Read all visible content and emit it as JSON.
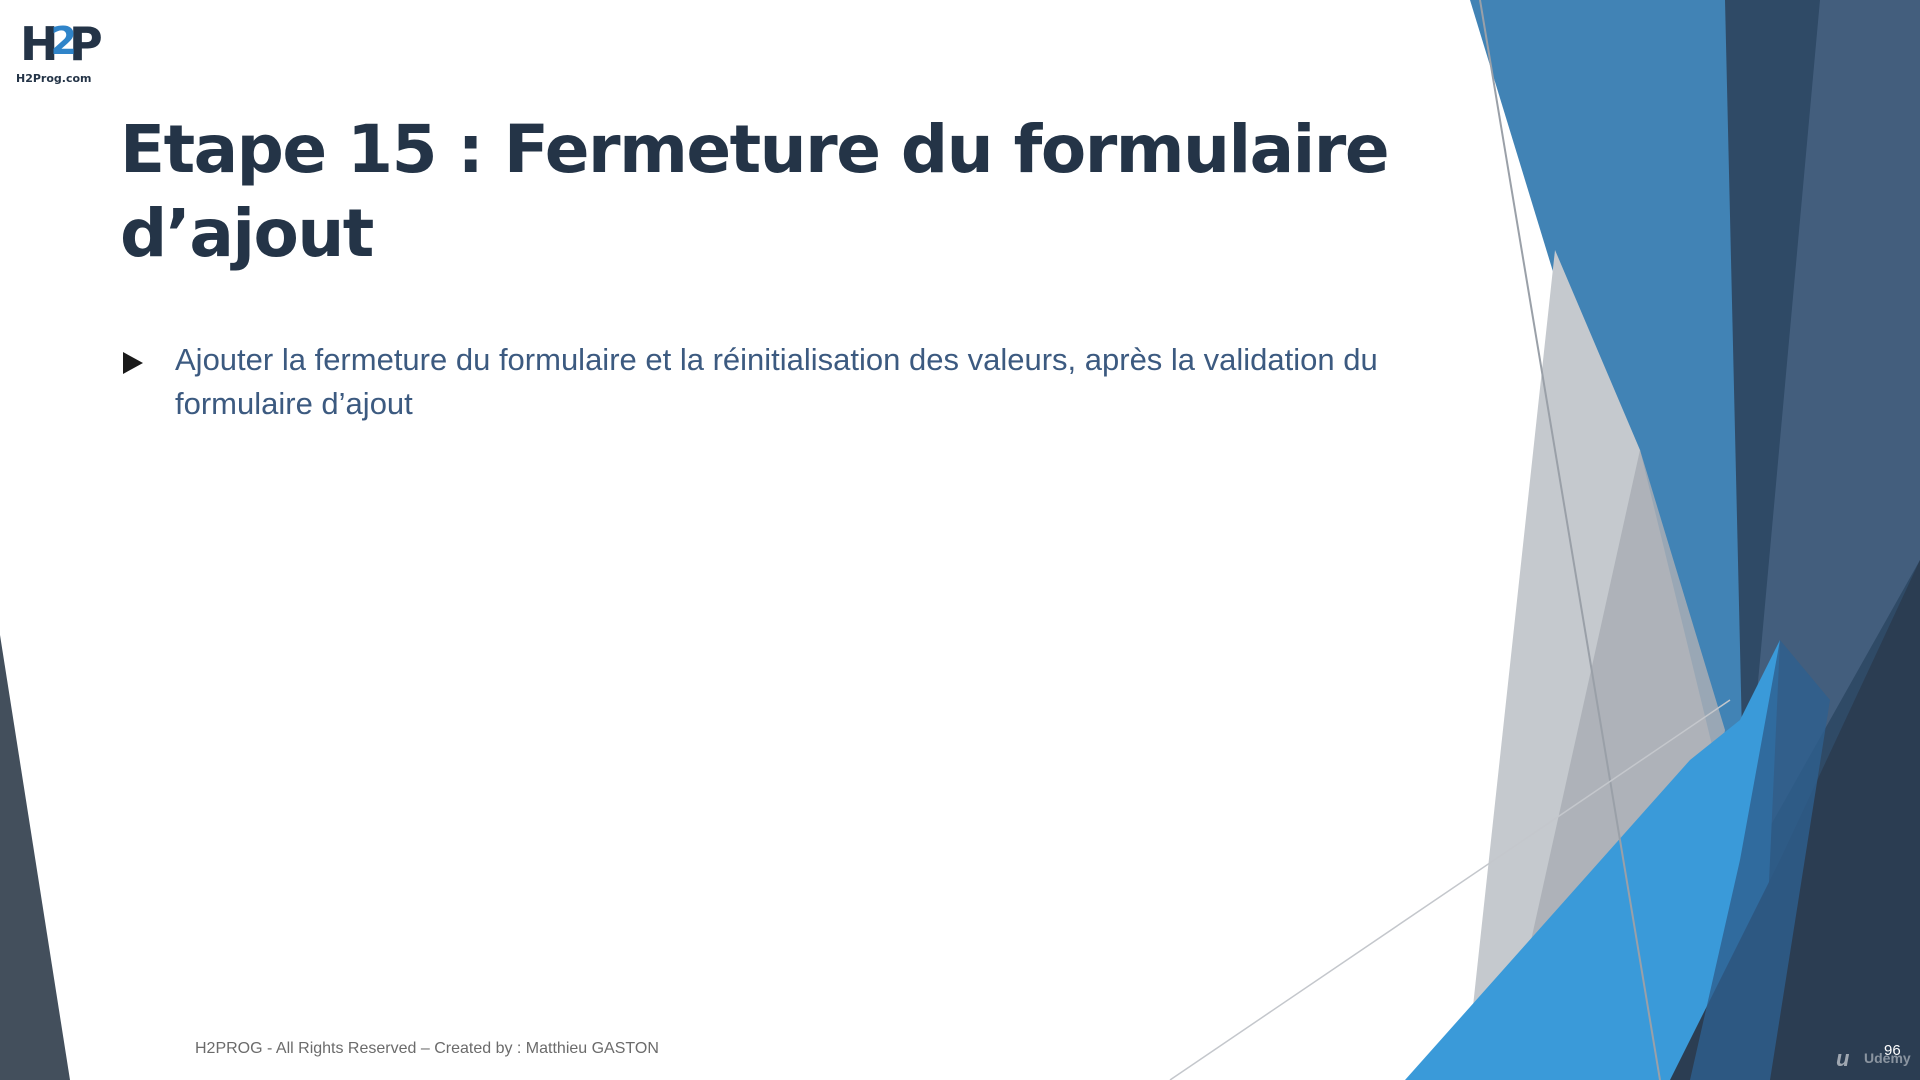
{
  "logo": {
    "mark_left": "H",
    "mark_mid": "2",
    "mark_right": "P",
    "site": "H2Prog.com"
  },
  "slide": {
    "title_line1": "Etape 15 : Fermeture du formulaire",
    "title_line2": "d’ajout",
    "bullets": [
      {
        "text": "Ajouter la fermeture du formulaire et la réinitialisation des valeurs, après la validation du formulaire d’ajout"
      }
    ],
    "footer": "H2PROG - All Rights Reserved – Created by : Matthieu GASTON",
    "page_number": "96"
  },
  "watermark": {
    "logo_glyph": "u",
    "text": "Udemy"
  },
  "colors": {
    "title": "#243447",
    "body_text": "#3c5a80",
    "accent_blue": "#2f84c9",
    "dark_navy": "#2b3a4c",
    "gray": "#b8bcc2"
  }
}
